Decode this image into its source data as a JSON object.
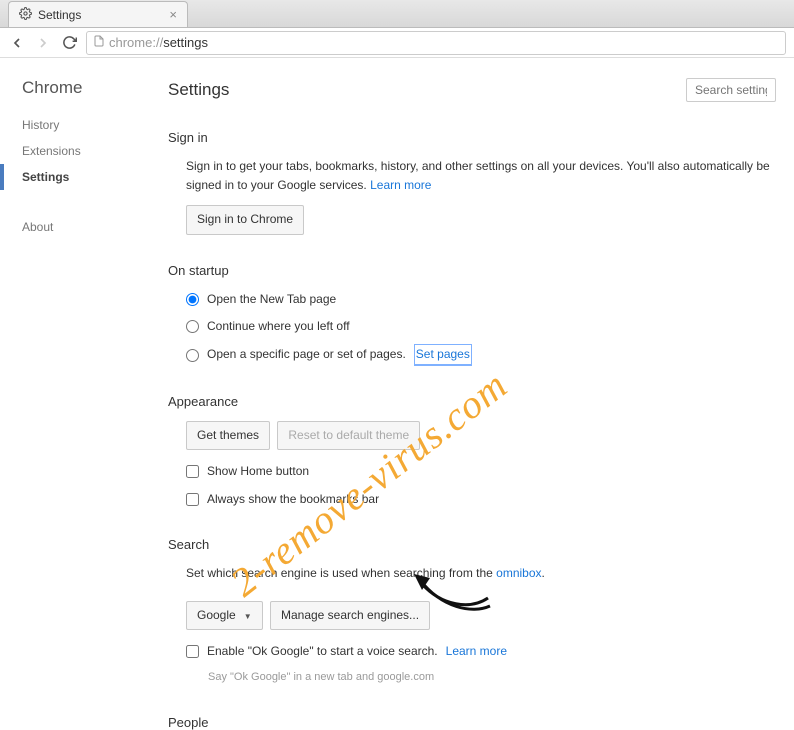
{
  "tab": {
    "title": "Settings"
  },
  "omnibox": {
    "scheme": "chrome://",
    "path": "settings"
  },
  "sidebar": {
    "title": "Chrome",
    "items": [
      {
        "label": "History"
      },
      {
        "label": "Extensions"
      },
      {
        "label": "Settings"
      },
      {
        "label": "About"
      }
    ]
  },
  "header": {
    "title": "Settings",
    "search_placeholder": "Search settings"
  },
  "signin": {
    "heading": "Sign in",
    "desc_a": "Sign in to get your tabs, bookmarks, history, and other settings on all your devices. You'll also automatically be signed in to your Google services. ",
    "learn_more": "Learn more",
    "button": "Sign in to Chrome"
  },
  "startup": {
    "heading": "On startup",
    "opts": [
      "Open the New Tab page",
      "Continue where you left off",
      "Open a specific page or set of pages."
    ],
    "set_pages": "Set pages"
  },
  "appearance": {
    "heading": "Appearance",
    "get_themes": "Get themes",
    "reset_theme": "Reset to default theme",
    "show_home": "Show Home button",
    "show_bookmarks": "Always show the bookmarks bar"
  },
  "search": {
    "heading": "Search",
    "desc_a": "Set which search engine is used when searching from the ",
    "omnibox_link": "omnibox",
    "engine": "Google",
    "manage": "Manage search engines...",
    "ok_google": "Enable \"Ok Google\" to start a voice search. ",
    "learn_more": "Learn more",
    "ok_google_sub": "Say \"Ok Google\" in a new tab and google.com"
  },
  "people": {
    "heading": "People"
  },
  "watermark": "2-remove-virus.com"
}
